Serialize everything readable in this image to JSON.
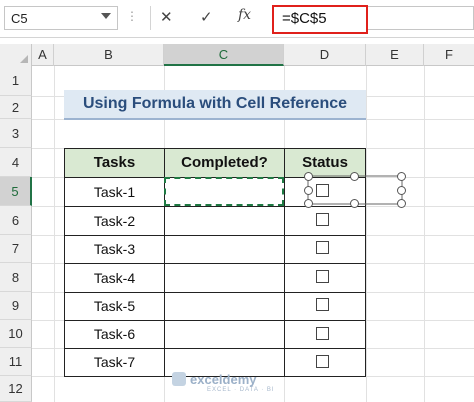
{
  "formula_bar": {
    "name_box": "C5",
    "dots": "⋮",
    "cancel_glyph": "✕",
    "confirm_glyph": "✓",
    "fx_label": "fx",
    "formula": "=$C$5"
  },
  "columns": [
    "A",
    "B",
    "C",
    "D",
    "E",
    "F"
  ],
  "rows": [
    "1",
    "2",
    "3",
    "4",
    "5",
    "6",
    "7",
    "8",
    "9",
    "10",
    "11",
    "12"
  ],
  "title": "Using Formula with Cell Reference",
  "table": {
    "headers": [
      "Tasks",
      "Completed?",
      "Status"
    ],
    "tasks": [
      "Task-1",
      "Task-2",
      "Task-3",
      "Task-4",
      "Task-5",
      "Task-6",
      "Task-7"
    ]
  },
  "watermark": {
    "brand": "exceldemy",
    "tagline": "EXCEL · DATA · BI"
  },
  "colors": {
    "accent": "#217346",
    "formula_highlight": "#e0201b",
    "title_fill": "#dfe9f3",
    "header_fill": "#d9e9d2"
  }
}
